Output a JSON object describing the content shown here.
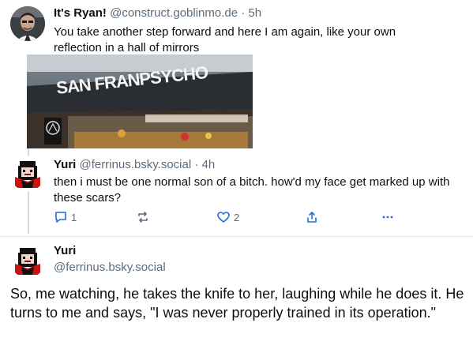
{
  "post1": {
    "author": "It's Ryan!",
    "handle": "@construct.goblinmo.de",
    "separator": "·",
    "time": "5h",
    "text": "You take another step forward and here I am again, like your own reflection in a hall of mirrors",
    "image": {
      "storefront_sign": "SAN FRANPSYCHO"
    }
  },
  "reply": {
    "author": "Yuri",
    "handle": "@ferrinus.bsky.social",
    "separator": "·",
    "time": "4h",
    "text": "then i must be one normal son of a bitch. how'd my face get marked up with these scars?",
    "actions": {
      "reply_count": "1",
      "repost_count": "",
      "like_count": "2"
    }
  },
  "main": {
    "author": "Yuri",
    "handle": "@ferrinus.bsky.social",
    "text": "So, me watching, he takes the knife to her, laughing while he does it. He turns to me and says, \"I was never properly trained in its operation.\""
  },
  "colors": {
    "accent_icon": "#1d6fe0",
    "muted": "#5b6b7b",
    "thread_line": "#d4dbe2"
  }
}
